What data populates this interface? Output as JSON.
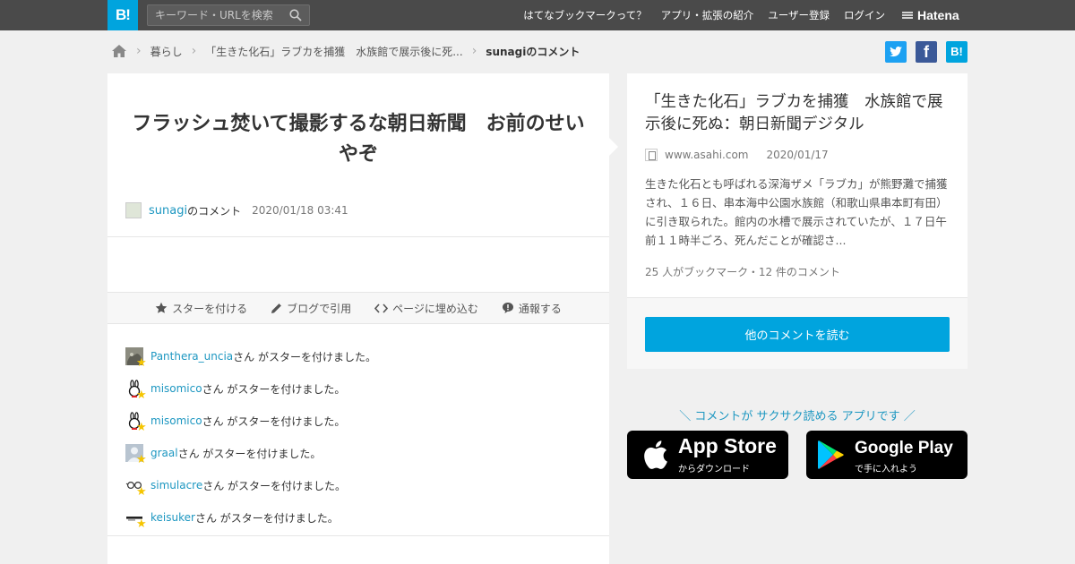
{
  "header": {
    "logo_text": "B!",
    "search_placeholder": "キーワード・URLを検索",
    "nav": [
      {
        "label": "はてなブックマークって？"
      },
      {
        "label": "アプリ・拡張の紹介"
      },
      {
        "label": "ユーザー登録"
      },
      {
        "label": "ログイン"
      }
    ],
    "brand": "Hatena"
  },
  "breadcrumb": {
    "items": [
      {
        "label": "暮らし"
      },
      {
        "label": "「生きた化石」ラブカを捕獲　水族館で展示後に死..."
      },
      {
        "label": "sunagiのコメント"
      }
    ]
  },
  "share": {
    "twitter_color": "#1da1f2",
    "facebook_color": "#3b5998",
    "hatena_color": "#00a4de",
    "hatena_label": "B!"
  },
  "comment": {
    "text": "フラッシュ焚いて撮影するな朝日新聞　お前のせいやぞ",
    "user": "sunagi",
    "suffix": "のコメント",
    "date": "2020/01/18 03:41"
  },
  "actions": [
    {
      "label": "スターを付ける",
      "icon": "star-icon"
    },
    {
      "label": "ブログで引用",
      "icon": "pencil-icon"
    },
    {
      "label": "ページに埋め込む",
      "icon": "code-icon"
    },
    {
      "label": "通報する",
      "icon": "alert-icon"
    }
  ],
  "stars": [
    {
      "user": "Panthera_uncia",
      "text": "さん がスターを付けました。",
      "avatar": "photo"
    },
    {
      "user": "misomico",
      "text": "さん がスターを付けました。",
      "avatar": "rabbit"
    },
    {
      "user": "misomico",
      "text": "さん がスターを付けました。",
      "avatar": "rabbit"
    },
    {
      "user": "graal",
      "text": "さん がスターを付けました。",
      "avatar": "default"
    },
    {
      "user": "simulacre",
      "text": "さん がスターを付けました。",
      "avatar": "glasses"
    },
    {
      "user": "keisuker",
      "text": "さん がスターを付けました。",
      "avatar": "text"
    }
  ],
  "article": {
    "title": "「生きた化石」ラブカを捕獲　水族館で展示後に死ぬ：朝日新聞デジタル",
    "domain": "www.asahi.com",
    "date": "2020/01/17",
    "summary": "生きた化石とも呼ばれる深海ザメ「ラブカ」が熊野灘で捕獲され、１６日、串本海中公園水族館（和歌山県串本町有田）に引き取られた。館内の水槽で展示されていたが、１７日午前１１時半ごろ、死んだことが確認さ...",
    "count": "25 人がブックマーク・12 件のコメント",
    "button_label": "他のコメントを読む"
  },
  "promo": {
    "text": "＼ コメントが サクサク読める アプリです ／",
    "appstore_big": "App Store",
    "appstore_small": "からダウンロード",
    "googleplay_big": "Google Play",
    "googleplay_small": "で手に入れよう"
  },
  "colors": {
    "accent": "#00a4de",
    "link": "#1d97c1",
    "topbar": "#4a4a4a",
    "star": "#f5c500"
  }
}
